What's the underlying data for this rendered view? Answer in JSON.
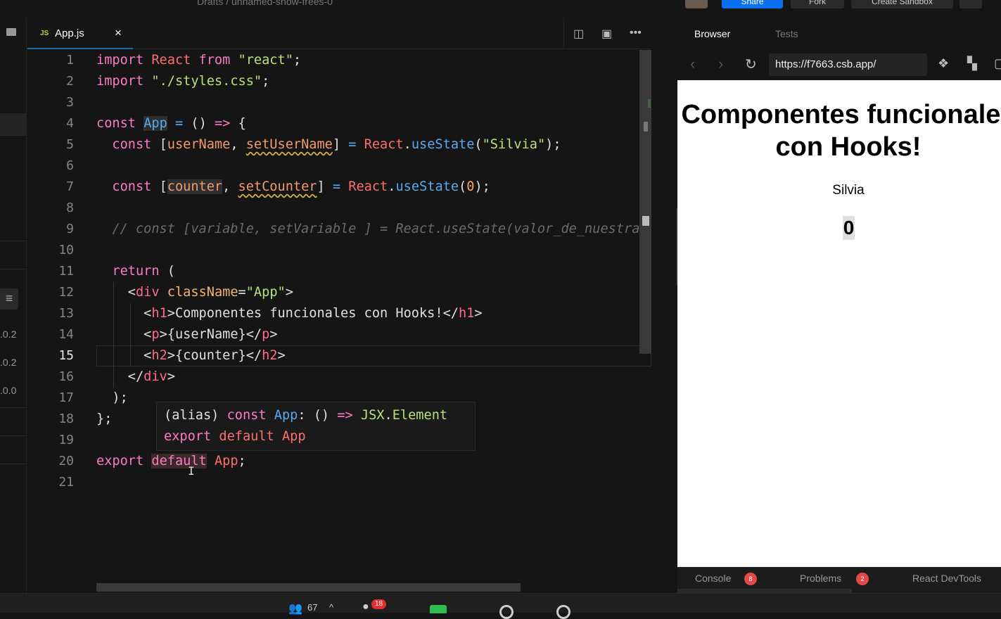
{
  "topbar": {
    "breadcrumb": "Drafts / unnamed-snow-frees-0",
    "share": "Share",
    "fork": "Fork",
    "create": "Create Sandbox"
  },
  "sidebar": {
    "versions": [
      ".0.2",
      ".0.2",
      ".0.0"
    ]
  },
  "editor": {
    "tab_label": "App.js",
    "tab_icon": "JS",
    "close": "×",
    "line_numbers": [
      "1",
      "2",
      "3",
      "4",
      "5",
      "6",
      "7",
      "8",
      "9",
      "10",
      "11",
      "12",
      "13",
      "14",
      "15",
      "16",
      "17",
      "18",
      "19",
      "20",
      "21"
    ],
    "active_line": "15",
    "lines": {
      "l1": [
        "import",
        " React ",
        "from",
        " ",
        "\"react\"",
        ";"
      ],
      "l2": [
        "import",
        " ",
        "\"./styles.css\"",
        ";"
      ],
      "l4": [
        "const",
        " ",
        "App",
        " ",
        "=",
        " () ",
        "=>",
        " {"
      ],
      "l5": [
        "  ",
        "const",
        " [",
        "userName",
        ", ",
        "setUserName",
        "] ",
        "=",
        " ",
        "React",
        ".",
        "useState",
        "(",
        "\"Silvia\"",
        ");"
      ],
      "l7": [
        "  ",
        "const",
        " [",
        "counter",
        ", ",
        "setCounter",
        "] ",
        "=",
        " ",
        "React",
        ".",
        "useState",
        "(",
        "0",
        ");"
      ],
      "l9": "  // const [variable, setVariable ] = React.useState(valor_de_nuestra",
      "l11": [
        "  ",
        "return",
        " ("
      ],
      "l12": [
        "    <",
        "div",
        " ",
        "className",
        "=",
        "\"App\"",
        ">"
      ],
      "l13": [
        "      <",
        "h1",
        ">Componentes funcionales con Hooks!</",
        "h1",
        ">"
      ],
      "l14": [
        "      <",
        "p",
        ">{userName}</",
        "p",
        ">"
      ],
      "l15": [
        "      <",
        "h2",
        ">{counter}</",
        "h2",
        ">"
      ],
      "l16": [
        "    </",
        "div",
        ">"
      ],
      "l17": "  );",
      "l18": "};",
      "l20": [
        "export",
        " ",
        "default",
        " ",
        "App",
        ";"
      ]
    },
    "tooltip": {
      "line1": [
        "(alias) ",
        "const",
        " ",
        "App",
        ": () ",
        "=>",
        " ",
        "JSX",
        ".",
        "Element"
      ],
      "line2": [
        "export",
        " ",
        "default",
        " ",
        "App"
      ]
    }
  },
  "preview": {
    "tabs": [
      "Browser",
      "Tests"
    ],
    "url": "https://f7663.csb.app/",
    "heading": "Componentes funcionales con Hooks!",
    "paragraph": "Silvia",
    "counter": "0",
    "devtools": {
      "console": "Console",
      "console_count": "8",
      "problems": "Problems",
      "problems_count": "2",
      "react": "React DevTools"
    }
  },
  "bottombar": {
    "participants": "67",
    "chat_count": "18"
  }
}
